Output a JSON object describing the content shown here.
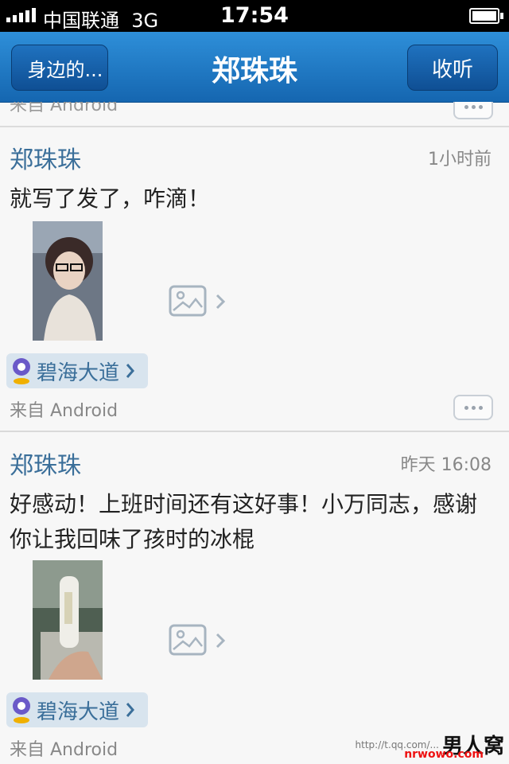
{
  "status_bar": {
    "carrier": "中国联通",
    "network": "3G",
    "time": "17:54"
  },
  "nav": {
    "back_label": "身边的...",
    "title": "郑珠珠",
    "right_label": "收听"
  },
  "peek": {
    "source": "来自 Android"
  },
  "posts": [
    {
      "author": "郑珠珠",
      "time": "1小时前",
      "text": "就写了发了，咋滴！",
      "location": "碧海大道",
      "source": "来自 Android"
    },
    {
      "author": "郑珠珠",
      "time": "昨天 16:08",
      "text": "好感动！上班时间还有这好事！小万同志，感谢你让我回味了孩时的冰棍",
      "location": "碧海大道",
      "source": "来自 Android"
    }
  ],
  "watermark": {
    "url": "http://t.qq.com/...",
    "brand": "男人窝",
    "sub": "nrwowo.com"
  },
  "colors": {
    "nav_blue": "#1f78c6",
    "link_blue": "#3b6f9a",
    "location_bg": "#d8e4ee"
  },
  "icons": [
    "signal-icon",
    "battery-icon",
    "more-options-icon",
    "image-icon",
    "location-pin-icon",
    "chevron-right-icon"
  ]
}
